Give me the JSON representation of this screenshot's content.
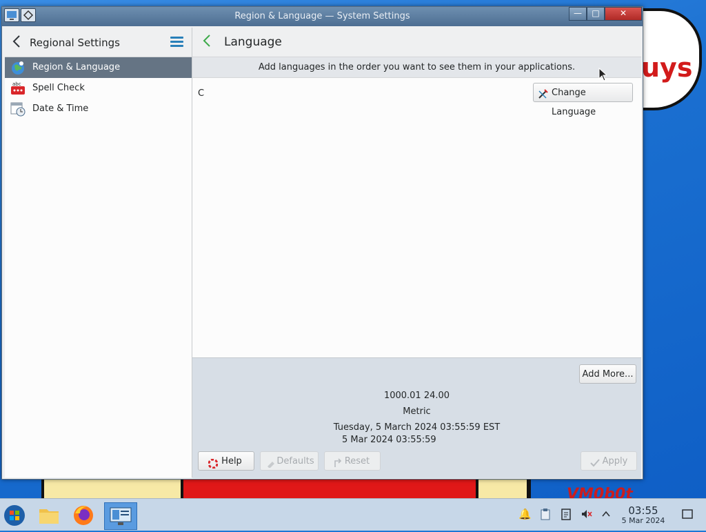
{
  "window": {
    "title": "Region & Language — System Settings",
    "minimize": "—",
    "maximize": "□",
    "close": "✕"
  },
  "sidebar": {
    "back_icon": "chevron-left-icon",
    "title": "Regional Settings",
    "menu_icon": "hamburger-menu-icon",
    "items": [
      {
        "label": "Region & Language",
        "icon": "globe-icon",
        "selected": true
      },
      {
        "label": "Spell Check",
        "icon": "spellcheck-icon",
        "selected": false
      },
      {
        "label": "Date & Time",
        "icon": "calendar-clock-icon",
        "selected": false
      }
    ]
  },
  "main": {
    "back_icon": "chevron-left-icon",
    "title": "Language",
    "hint": "Add languages in the order you want to see them in your applications.",
    "languages": [
      "C"
    ],
    "change_language_label": "Change Language",
    "add_more_label": "Add More...",
    "examples": {
      "number": "1000.01  24.00",
      "measurement": "Metric",
      "long_date": "Tuesday, 5 March 2024 03:55:59 EST",
      "short_date": "5 Mar 2024 03:55:59"
    },
    "buttons": {
      "help": "Help",
      "defaults": "Defaults",
      "reset": "Reset",
      "apply": "Apply"
    }
  },
  "taskbar": {
    "apps": [
      {
        "icon": "start-menu-icon"
      },
      {
        "icon": "file-manager-icon"
      },
      {
        "icon": "firefox-icon"
      },
      {
        "icon": "system-settings-icon",
        "active": true
      }
    ],
    "tray": [
      "notifications-icon",
      "clipboard-icon",
      "klipper-icon",
      "volume-muted-icon",
      "show-hidden-chevron-icon"
    ],
    "clock_time": "03:55",
    "clock_date": "5 Mar 2024"
  },
  "colors": {
    "accent": "#2980b9",
    "selection": "#657484",
    "back_green": "#3daa4a"
  }
}
